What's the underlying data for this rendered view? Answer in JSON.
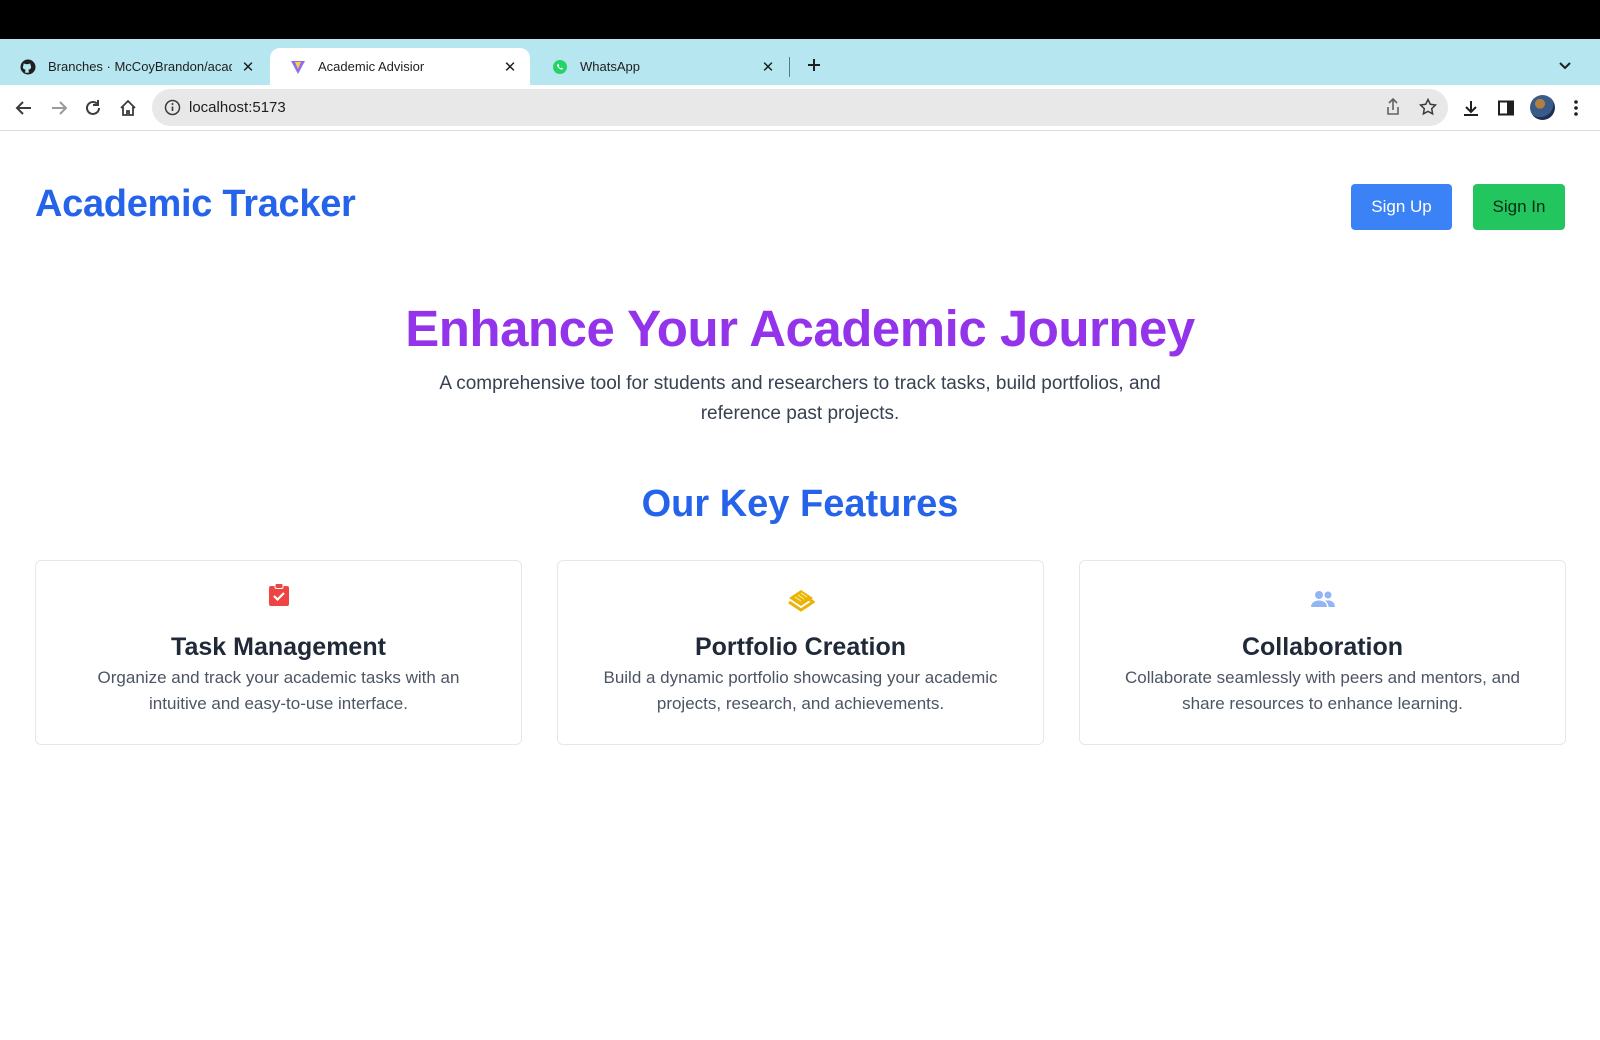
{
  "browser": {
    "tabs": [
      {
        "title": "Branches · McCoyBrandon/academic",
        "favicon": "github-icon"
      },
      {
        "title": "Academic Advisior",
        "favicon": "vite-icon"
      },
      {
        "title": "WhatsApp",
        "favicon": "whatsapp-icon"
      }
    ],
    "url": "localhost:5173",
    "tabstrip_color": "#b6e6f0"
  },
  "header": {
    "brand": "Academic Tracker",
    "signup_label": "Sign Up",
    "signin_label": "Sign In"
  },
  "hero": {
    "title": "Enhance Your Academic Journey",
    "subtitle": "A comprehensive tool for students and researchers to track tasks, build portfolios, and reference past projects."
  },
  "features": {
    "heading": "Our Key Features",
    "items": [
      {
        "icon": "clipboard-check-icon",
        "title": "Task Management",
        "description": "Organize and track your academic tasks with an intuitive and easy-to-use interface."
      },
      {
        "icon": "layers-icon",
        "title": "Portfolio Creation",
        "description": "Build a dynamic portfolio showcasing your academic projects, research, and achievements."
      },
      {
        "icon": "users-icon",
        "title": "Collaboration",
        "description": "Collaborate seamlessly with peers and mentors, and share resources to enhance learning."
      }
    ]
  },
  "colors": {
    "brand_blue": "#2563eb",
    "hero_purple": "#9333ea",
    "signup_blue": "#3b82f6",
    "signin_green": "#22c55e",
    "task_icon_red": "#ef4444",
    "portfolio_icon_yellow": "#eab308",
    "collab_icon_blue": "#93b4f5"
  }
}
